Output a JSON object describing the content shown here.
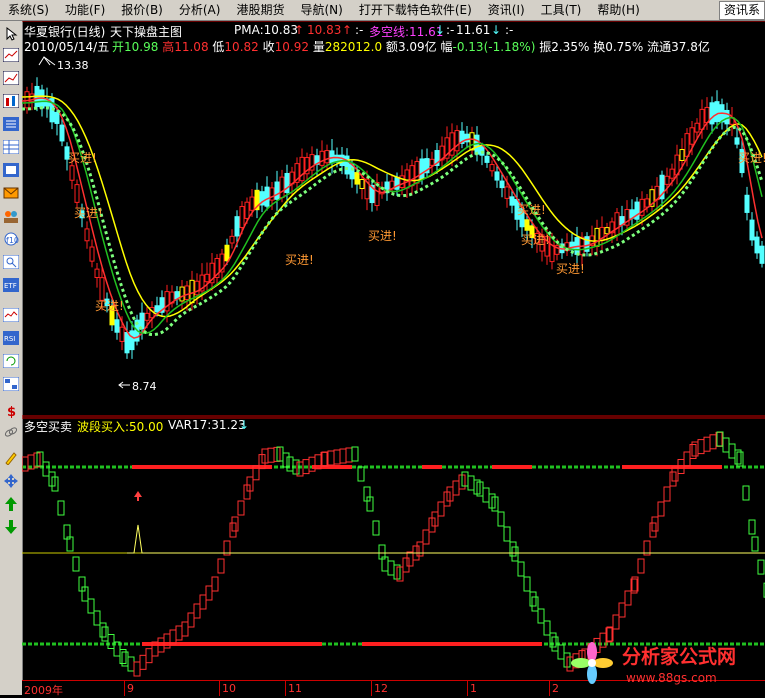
{
  "menu": {
    "items": [
      "系统(S)",
      "功能(F)",
      "报价(B)",
      "分析(A)",
      "港股期货",
      "导航(N)",
      "打开下载特色软件(E)",
      "资讯(I)",
      "工具(T)",
      "帮助(H)"
    ],
    "right_button": "资讯系"
  },
  "toolbar": {
    "icons": [
      "cursor-icon",
      "minute-chart-icon",
      "kline-icon",
      "bar-chart-icon",
      "list-icon",
      "grid-icon",
      "news-icon",
      "mail-icon",
      "users-icon",
      "f10-icon",
      "zoom-icon",
      "etf-icon",
      "indicator-icon",
      "rsi-icon",
      "refresh-icon",
      "window-icon",
      "dollar-icon",
      "link-icon",
      "pencil-icon",
      "move-icon",
      "up-arrow-icon",
      "down-arrow-icon"
    ]
  },
  "main_panel": {
    "stock_title": "华夏银行(日线)",
    "chart_name": "天下操盘主图",
    "pma_label": "PMA:10.83",
    "pma_value2": "10.83",
    "duokong_label": "多空线:11.61",
    "duokong_value2": "11.61",
    "arrow_extra": ":-",
    "info": {
      "date": "2010/05/14/五",
      "open_label": "开",
      "open": "10.98",
      "high_label": "高",
      "high": "11.08",
      "low_label": "低",
      "low": "10.82",
      "close_label": "收",
      "close": "10.92",
      "volume_label": "量",
      "volume": "282012.0",
      "amount_label": "额",
      "amount": "3.09亿",
      "change_label": "幅",
      "change": "-0.13(-1.18%)",
      "amplitude_label": "振",
      "amplitude": "2.35%",
      "turnover_label": "换",
      "turnover": "0.75%",
      "float_label": "流通",
      "float": "37.8亿"
    },
    "max_label": "13.38",
    "min_label": "8.74",
    "buy_signals": [
      "买进!",
      "买进!",
      "买进!",
      "买进!",
      "买进!",
      "买进!",
      "买进!",
      "买进!",
      "买进!"
    ]
  },
  "sub_panel": {
    "title": "多空买卖",
    "indicator1": "波段买入:50.00",
    "indicator2": "VAR17:31.23"
  },
  "x_axis": {
    "labels": [
      "2009年",
      "9",
      "10",
      "11",
      "12",
      "1",
      "2"
    ]
  },
  "watermark": {
    "text": "分析家公式网",
    "url": "www.88gs.com"
  },
  "colors": {
    "up": "#ff2020",
    "down": "#54ffff",
    "ma_yellow": "#ffff00",
    "ma_red": "#ff3030",
    "ma_green": "#20c020",
    "dotted": "#7cff7c",
    "pink": "#ff40ff",
    "label_orange": "#ff9933"
  }
}
